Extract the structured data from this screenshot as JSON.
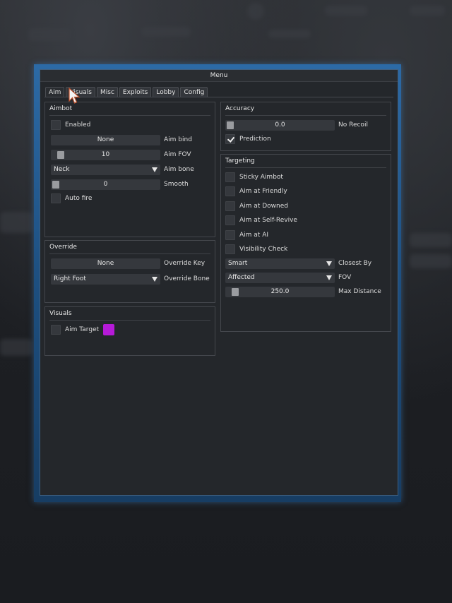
{
  "window": {
    "title": "Menu"
  },
  "tabs": [
    {
      "label": "Aim"
    },
    {
      "label": "Visuals"
    },
    {
      "label": "Misc"
    },
    {
      "label": "Exploits"
    },
    {
      "label": "Lobby"
    },
    {
      "label": "Config"
    }
  ],
  "aimbot": {
    "title": "Aimbot",
    "enabled_label": "Enabled",
    "enabled_checked": false,
    "aim_bind_value": "None",
    "aim_bind_label": "Aim bind",
    "aim_fov_value": "10",
    "aim_fov_fraction": 0.05,
    "aim_fov_label": "Aim FOV",
    "aim_bone_value": "Neck",
    "aim_bone_label": "Aim bone",
    "smooth_value": "0",
    "smooth_fraction": 0,
    "smooth_label": "Smooth",
    "auto_fire_label": "Auto fire",
    "auto_fire_checked": false
  },
  "override": {
    "title": "Override",
    "key_value": "None",
    "key_label": "Override Key",
    "bone_value": "Right Foot",
    "bone_label": "Override Bone"
  },
  "visuals": {
    "title": "Visuals",
    "aim_target_label": "Aim Target",
    "aim_target_checked": false,
    "aim_target_color": "#b61ad8"
  },
  "accuracy": {
    "title": "Accuracy",
    "no_recoil_value": "0.0",
    "no_recoil_fraction": 0,
    "no_recoil_label": "No Recoil",
    "prediction_label": "Prediction",
    "prediction_checked": true
  },
  "targeting": {
    "title": "Targeting",
    "sticky_label": "Sticky Aimbot",
    "friendly_label": "Aim at Friendly",
    "downed_label": "Aim at Downed",
    "self_revive_label": "Aim at Self-Revive",
    "ai_label": "Aim at AI",
    "visibility_label": "Visibility Check",
    "closest_by_value": "Smart",
    "closest_by_label": "Closest By",
    "fov_value": "Affected",
    "fov_label": "FOV",
    "max_distance_value": "250.0",
    "max_distance_fraction": 0.05,
    "max_distance_label": "Max Distance"
  },
  "colors": {
    "accent_frame": "#2c6aa6",
    "panel": "#24272b",
    "control": "#35383d"
  }
}
